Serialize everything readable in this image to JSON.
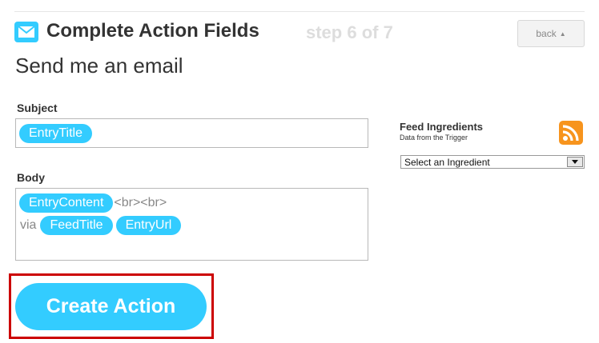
{
  "header": {
    "title": "Complete Action Fields",
    "step": "step 6 of 7",
    "back_label": "back",
    "icon": "mail-icon"
  },
  "action_name": "Send me an email",
  "subject": {
    "label": "Subject",
    "tokens": [
      "EntryTitle"
    ]
  },
  "body": {
    "label": "Body",
    "line1": {
      "token": "EntryContent",
      "text": "<br><br>"
    },
    "line2": {
      "text": "via",
      "tokens": [
        "FeedTitle",
        "EntryUrl"
      ]
    }
  },
  "create_button": {
    "label": "Create Action"
  },
  "feed_ingredients": {
    "title": "Feed Ingredients",
    "subtitle": "Data from the Trigger",
    "select_value": "Select an Ingredient",
    "icon": "rss-icon"
  },
  "colors": {
    "accent": "#33ccff",
    "highlight_outline": "#cc0000",
    "rss_orange": "#f7941d"
  }
}
